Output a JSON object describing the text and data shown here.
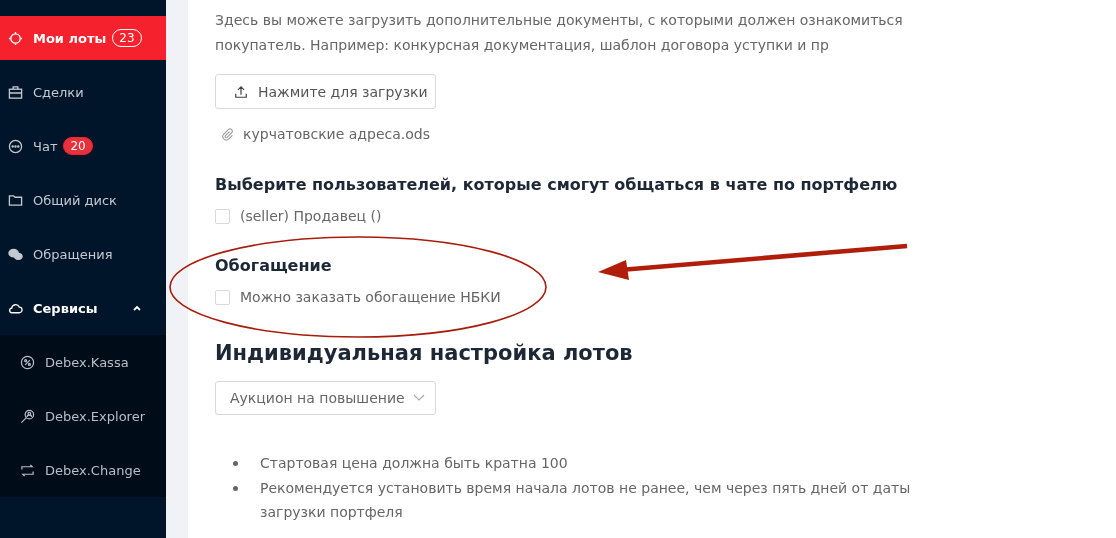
{
  "sidebar": {
    "items": [
      {
        "label": "Мои лоты",
        "badge": "23",
        "selected": true
      },
      {
        "label": "Сделки",
        "selected": false
      },
      {
        "label": "Чат",
        "badge": "20",
        "selected": false
      },
      {
        "label": "Общий диск",
        "selected": false
      },
      {
        "label": "Обращения",
        "selected": false
      },
      {
        "label": "Сервисы",
        "selected": false,
        "expanded": true,
        "children": [
          {
            "label": "Debex.Kassa"
          },
          {
            "label": "Debex.Explorer"
          },
          {
            "label": "Debex.Change"
          }
        ]
      }
    ]
  },
  "documents": {
    "description": "Здесь вы можете загрузить дополнительные документы, с которыми должен ознакомиться покупатель. Например: конкурсная документация, шаблон договора уступки и пр",
    "upload_button": "Нажмите для загрузки",
    "files": [
      "курчатовские адреса.ods"
    ]
  },
  "chat_users": {
    "title": "Выберите пользователей, которые смогут общаться в чате по портфелю",
    "options": [
      {
        "label": "(seller) Продавец ()",
        "checked": false
      }
    ]
  },
  "enrichment": {
    "title": "Обогащение",
    "options": [
      {
        "label": "Можно заказать обогащение НБКИ",
        "checked": false
      }
    ]
  },
  "lot_settings": {
    "title": "Индивидуальная настройка лотов",
    "select_value": "Аукцион на повышение",
    "notes": [
      "Стартовая цена должна быть кратна 100",
      "Рекомендуется установить время начала лотов не ранее, чем через пять дней от даты загрузки портфеля"
    ]
  }
}
